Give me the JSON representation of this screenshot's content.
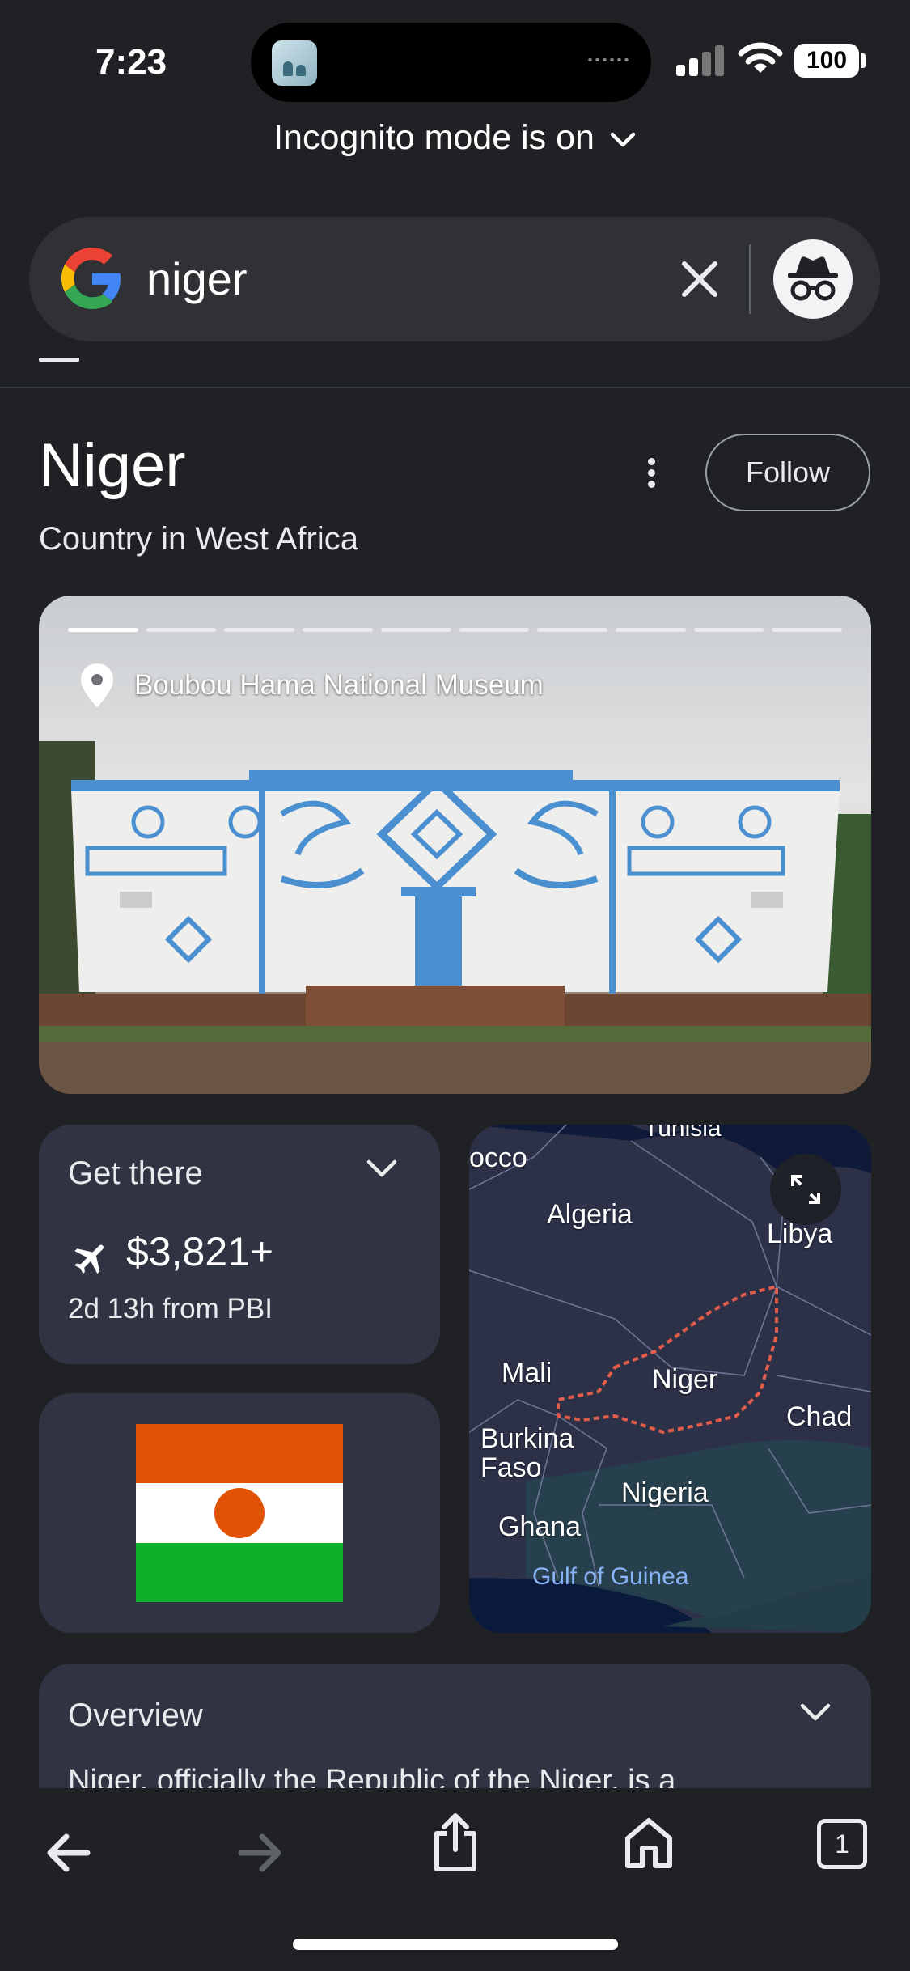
{
  "status_bar": {
    "time": "7:23",
    "battery": "100"
  },
  "incognito": {
    "label": "Incognito mode is on"
  },
  "search": {
    "query": "niger"
  },
  "entity": {
    "title": "Niger",
    "subtitle": "Country in West Africa",
    "follow_label": "Follow"
  },
  "photo": {
    "place": "Boubou Hama National Museum",
    "slides_total": 10,
    "slide_active": 1
  },
  "get_there": {
    "title": "Get there",
    "price": "$3,821+",
    "detail": "2d 13h from PBI"
  },
  "flag": {
    "colors": [
      "#e05206",
      "#ffffff",
      "#0db02b"
    ],
    "disc": "#e05206"
  },
  "map": {
    "labels": {
      "top": "Tunisia",
      "morocco": "occo",
      "algeria": "Algeria",
      "libya": "Libya",
      "mali": "Mali",
      "niger": "Niger",
      "chad": "Chad",
      "burkina": "Burkina\nFaso",
      "nigeria": "Nigeria",
      "ghana": "Ghana",
      "gulf": "Gulf of Guinea"
    }
  },
  "overview": {
    "title": "Overview",
    "text": "Niger, officially the Republic of the Niger, is a"
  }
}
